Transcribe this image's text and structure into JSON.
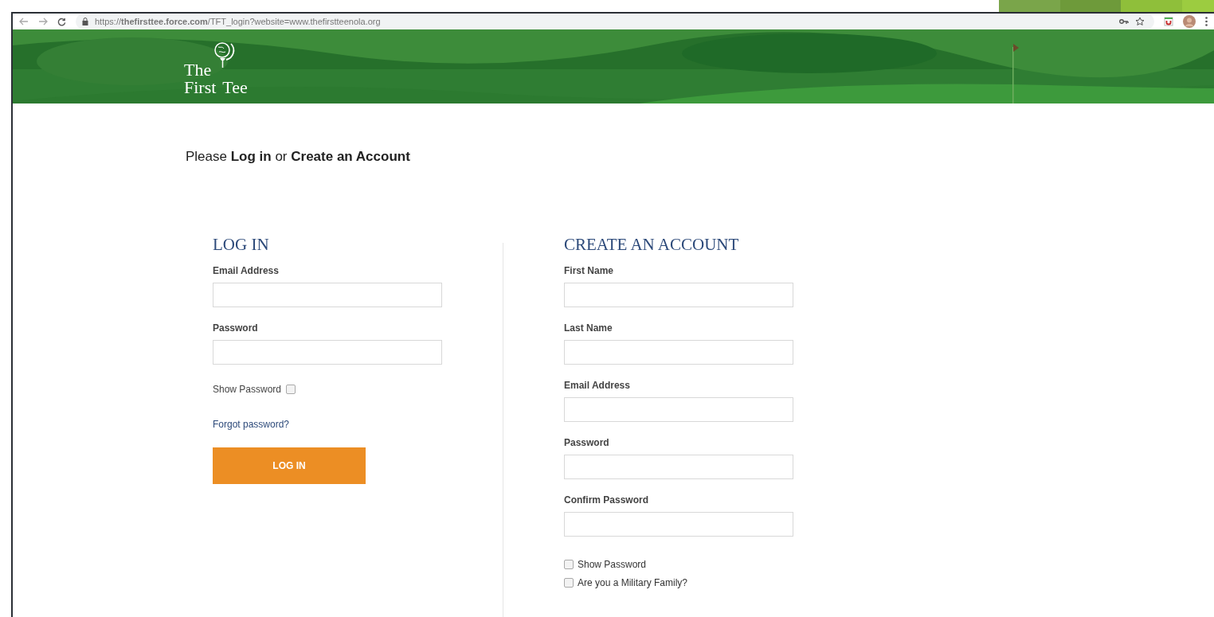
{
  "browser": {
    "url": "https://**thefirsttee.force.com**/TFT_login?website=www.thefirstteenola.org"
  },
  "banner": {
    "logo": [
      "The",
      "First",
      "Tee"
    ]
  },
  "intro": "Please **Log in** or **Create an Account**",
  "login": {
    "heading": "LOG IN",
    "fields": [
      {
        "label": "Email Address"
      },
      {
        "label": "Password"
      }
    ],
    "show_password": {
      "label": "Show Password",
      "checked": false
    },
    "forgot": "Forgot password?",
    "button": "LOG IN"
  },
  "create": {
    "heading": "CREATE AN ACCOUNT",
    "fields": [
      {
        "label": "First Name"
      },
      {
        "label": "Last Name"
      },
      {
        "label": "Email Address"
      },
      {
        "label": "Password"
      },
      {
        "label": "Confirm Password"
      }
    ],
    "options": [
      {
        "label": "Show Password",
        "checked": false
      },
      {
        "label": "Are you a Military Family?",
        "checked": false
      }
    ]
  }
}
